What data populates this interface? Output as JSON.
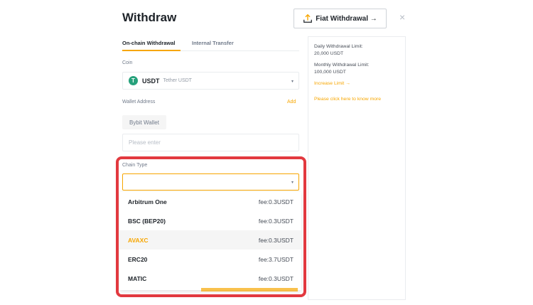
{
  "header": {
    "title": "Withdraw",
    "fiat_button_label": "Fiat Withdrawal →",
    "close_glyph": "×"
  },
  "tabs": [
    {
      "label": "On-chain Withdrawal",
      "active": true
    },
    {
      "label": "Internal Transfer",
      "active": false
    }
  ],
  "coin": {
    "label": "Coin",
    "icon_glyph": "T",
    "code": "USDT",
    "name": "Tether USDT",
    "icon_color": "#26a17b"
  },
  "wallet": {
    "label": "Wallet Address",
    "add_label": "Add",
    "saved_chip": "Bybit Wallet",
    "placeholder": "Please enter"
  },
  "chain": {
    "label": "Chain Type",
    "value": "",
    "options": [
      {
        "name": "Arbitrum One",
        "fee": "fee:0.3USDT",
        "highlighted": false
      },
      {
        "name": "BSC (BEP20)",
        "fee": "fee:0.3USDT",
        "highlighted": false
      },
      {
        "name": "AVAXC",
        "fee": "fee:0.3USDT",
        "highlighted": true
      },
      {
        "name": "ERC20",
        "fee": "fee:3.7USDT",
        "highlighted": false
      },
      {
        "name": "MATIC",
        "fee": "fee:0.3USDT",
        "highlighted": false
      }
    ]
  },
  "side": {
    "daily_label": "Daily Withdrawal Limit:",
    "daily_value": "20,000 USDT",
    "monthly_label": "Monthly Withdrawal Limit:",
    "monthly_value": "100,000 USDT",
    "increase_link": "Increase Limit →",
    "help_link": "Please click here to know more"
  },
  "colors": {
    "accent": "#f7a600",
    "highlight_frame": "#e2393f"
  },
  "icons": {
    "fiat": "upload-icon",
    "close": "close-icon",
    "coin": "tether-icon",
    "dropdown": "chevron-down-icon"
  }
}
